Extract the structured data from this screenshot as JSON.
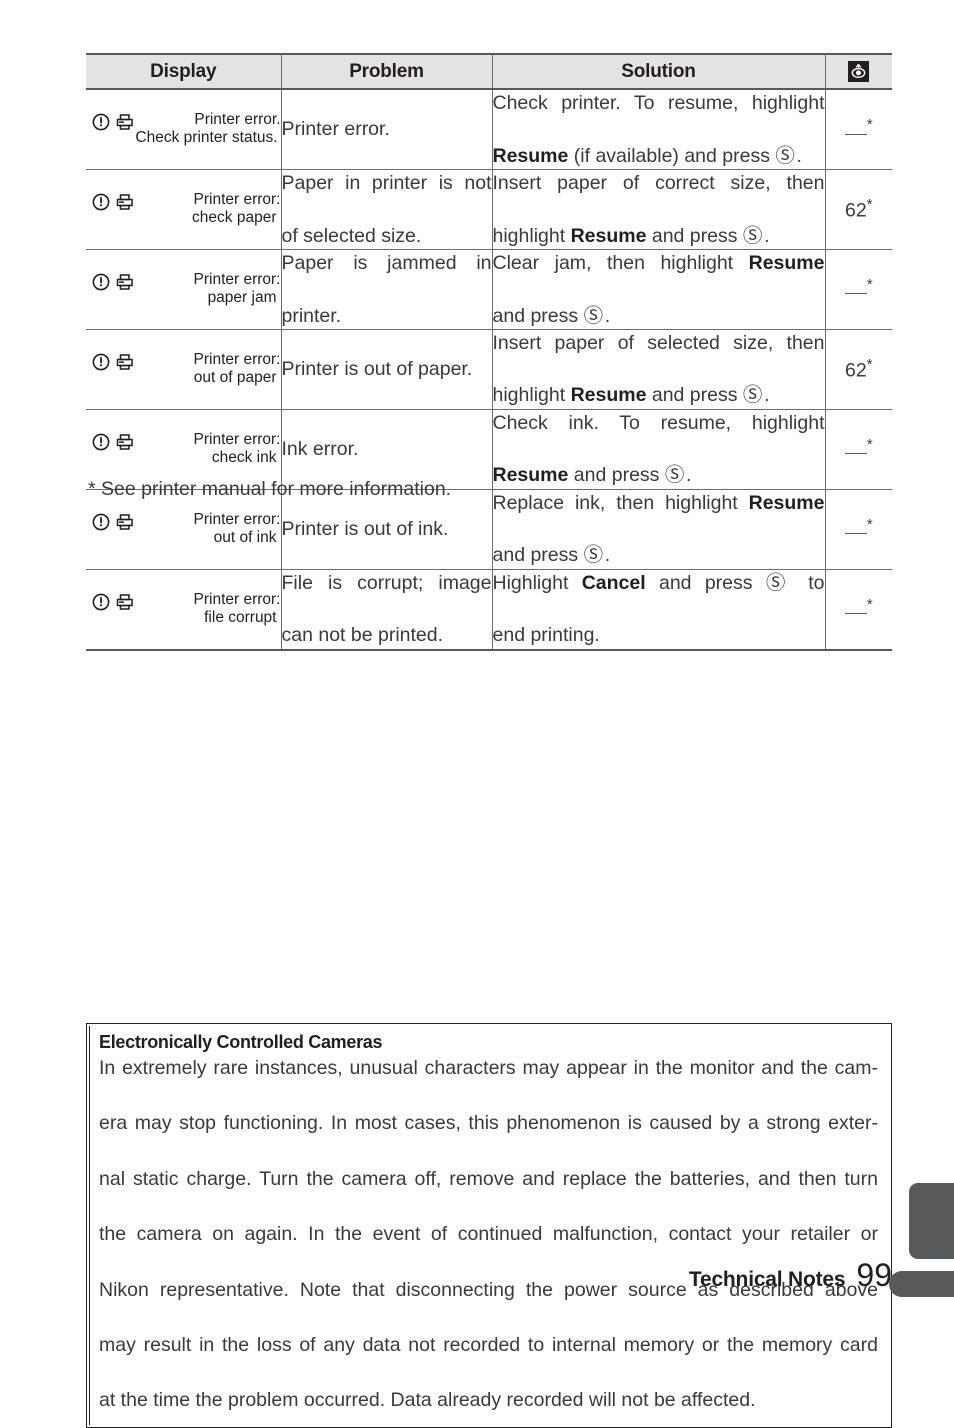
{
  "table": {
    "headers": {
      "display": "Display",
      "problem": "Problem",
      "solution": "Solution",
      "reference_icon": "reference-eye-icon"
    },
    "rows": [
      {
        "display_line1": "Printer error.",
        "display_line2": "Check printer status.",
        "problem_l1": "Printer error.",
        "problem_l2": "",
        "solution_l1": "Check printer.  To resume, highlight",
        "solution_l2_bold": "Resume",
        "solution_l2_rest": " (if available) and press ",
        "solution_l2_tail": ".",
        "reference": "—",
        "reference_star": "*"
      },
      {
        "display_line1": "Printer error:",
        "display_line2": "check paper",
        "problem_l1": "Paper in printer is not",
        "problem_l2": "of selected size.",
        "solution_l1": "Insert paper of correct size, then",
        "solution_l2_pre": "highlight ",
        "solution_l2_bold": "Resume",
        "solution_l2_rest": " and press ",
        "solution_l2_tail": ".",
        "reference": "62",
        "reference_star": "*"
      },
      {
        "display_line1": "Printer error:",
        "display_line2": "paper jam",
        "problem_l1": "Paper is jammed in",
        "problem_l2": "printer.",
        "solution_l1_pre": "Clear jam, then highlight ",
        "solution_l1_bold": "Resume",
        "solution_l2_rest": "and press ",
        "solution_l2_tail": ".",
        "reference": "—",
        "reference_star": "*"
      },
      {
        "display_line1": "Printer error:",
        "display_line2": "out of paper",
        "problem_l1": "Printer is out of paper.",
        "problem_l2": "",
        "solution_l1": "Insert paper of selected size, then",
        "solution_l2_pre": "highlight ",
        "solution_l2_bold": "Resume",
        "solution_l2_rest": " and press ",
        "solution_l2_tail": ".",
        "reference": "62",
        "reference_star": "*"
      },
      {
        "display_line1": "Printer error:",
        "display_line2": "check ink",
        "problem_l1": "Ink error.",
        "problem_l2": "",
        "solution_l1": "Check ink.  To resume, highlight",
        "solution_l2_bold": "Resume",
        "solution_l2_rest": " and press ",
        "solution_l2_tail": ".",
        "reference": "—",
        "reference_star": "*"
      },
      {
        "display_line1": "Printer error:",
        "display_line2": "out of ink",
        "problem_l1": "Printer is out of ink.",
        "problem_l2": "",
        "solution_l1_pre": "Replace ink, then highlight ",
        "solution_l1_bold": "Resume",
        "solution_l2_rest": "and press ",
        "solution_l2_tail": ".",
        "reference": "—",
        "reference_star": "*"
      },
      {
        "display_line1": "Printer error:",
        "display_line2": "file corrupt",
        "problem_l1": "File is corrupt; image",
        "problem_l2": "can not be printed.",
        "solution_l1_pre": "Highlight ",
        "solution_l1_bold": "Cancel",
        "solution_l1_post": " and press ",
        "solution_l1_tail": " to",
        "solution_l2_rest": "end printing.",
        "reference": "—",
        "reference_star": "*"
      }
    ]
  },
  "footnote": "* See printer manual for more information.",
  "note_box": {
    "title": "Electronically Controlled Cameras",
    "lines": [
      "In extremely rare instances, unusual characters may appear in the monitor and the cam-",
      "era may stop functioning.  In most cases, this phenomenon is caused by a strong exter-",
      "nal static charge.  Turn the camera off, remove and replace the batteries, and then turn",
      "the camera on again.  In the event of continued malfunction, contact your retailer or",
      "Nikon representative.  Note that disconnecting the power source as described above",
      "may result in the loss of any data not recorded to internal memory or the memory card",
      "at the time the problem occurred.  Data already recorded will not be affected."
    ]
  },
  "footer": {
    "chapter": "Technical Notes",
    "page_number": "99"
  },
  "colors": {
    "header_fill": "#e3e3e3",
    "rule": "#58595b",
    "text": "#3a3a3a",
    "tab_gray": "#58595b"
  }
}
